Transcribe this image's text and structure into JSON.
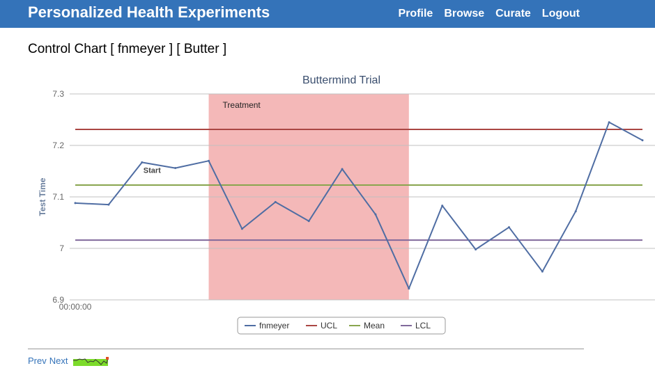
{
  "nav": {
    "brand": "Personalized Health Experiments",
    "links": [
      "Profile",
      "Browse",
      "Curate",
      "Logout"
    ]
  },
  "page": {
    "title": "Control Chart [ fnmeyer ] [ Butter ]"
  },
  "pager": {
    "prev": "Prev",
    "next": "Next"
  },
  "colors": {
    "nav_bg": "#3473b9",
    "series": "#4f6da3",
    "ucl": "#aa4643",
    "mean": "#89a54e",
    "lcl": "#80699b",
    "treatment_band": "#f4b8b8"
  },
  "chart_data": {
    "type": "line",
    "title": "Buttermind Trial",
    "ylabel": "Test Time",
    "ylim": [
      6.9,
      7.3
    ],
    "yticks": [
      6.9,
      7,
      7.1,
      7.2,
      7.3
    ],
    "ytick_labels": [
      "6.9",
      "7",
      "7.1",
      "7.2",
      "7.3"
    ],
    "xtick_label": "00:00:00",
    "legend": [
      "fnmeyer",
      "UCL",
      "Mean",
      "LCL"
    ],
    "legend_position": "bottom-center",
    "series": [
      {
        "name": "fnmeyer",
        "values": [
          7.088,
          7.085,
          7.167,
          7.156,
          7.17,
          7.038,
          7.09,
          7.053,
          7.154,
          7.066,
          6.922,
          7.083,
          6.998,
          7.041,
          6.955,
          7.072,
          7.245,
          7.21
        ]
      }
    ],
    "control_lines": {
      "UCL": 7.231,
      "Mean": 7.123,
      "LCL": 7.016
    },
    "bands": [
      {
        "label": "Treatment",
        "from_index": 4,
        "to_index": 10
      }
    ],
    "annotations": [
      {
        "text": "Start",
        "index": 2
      }
    ]
  }
}
